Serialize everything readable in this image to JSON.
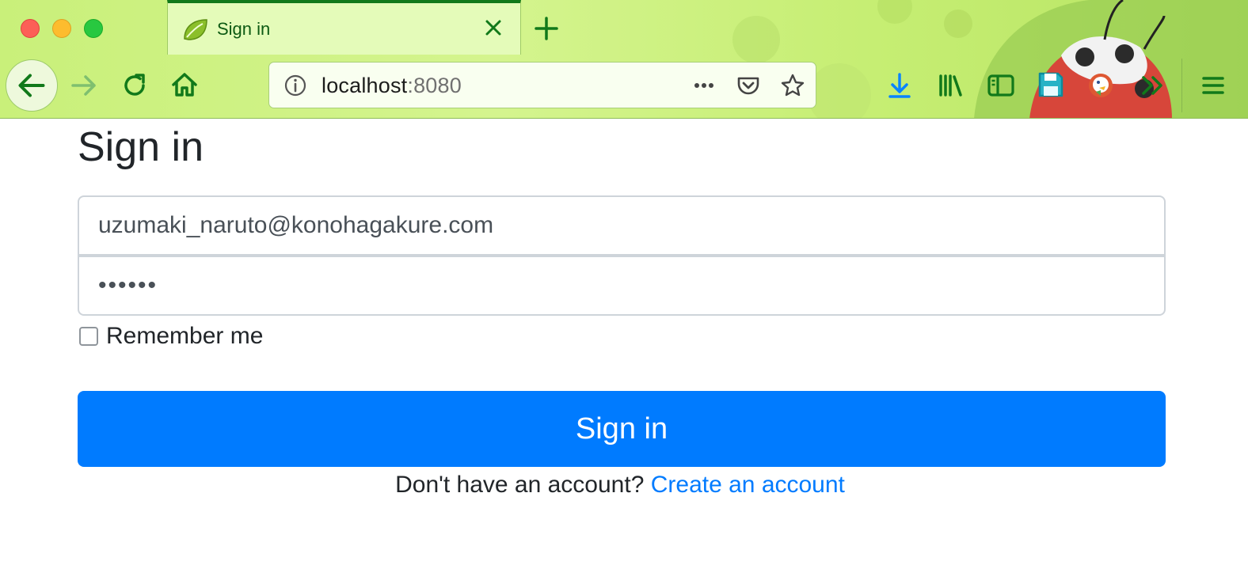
{
  "browser": {
    "tab": {
      "title": "Sign in",
      "favicon": "spring-leaf-icon"
    },
    "url": {
      "host": "localhost",
      "port": ":8080"
    },
    "toolbar_icons": [
      "back-arrow-icon",
      "forward-arrow-icon",
      "reload-icon",
      "home-icon",
      "info-icon",
      "more-icon",
      "pocket-icon",
      "star-icon",
      "download-icon",
      "library-icon",
      "sidebar-icon",
      "save-icon",
      "duckduckgo-icon",
      "overflow-chevron-icon",
      "menu-icon"
    ],
    "colors": {
      "accent": "#11791a",
      "theme_background": "#c9f07a",
      "download_blue": "#0a84ff"
    }
  },
  "page": {
    "title": "Sign in",
    "email": {
      "value": "uzumaki_naruto@konohagakure.com"
    },
    "password": {
      "value": "••••••"
    },
    "remember_me": {
      "label": "Remember me",
      "checked": false
    },
    "submit_label": "Sign in",
    "footer": {
      "text": "Don't have an account?",
      "link_text": "Create an account"
    },
    "colors": {
      "primary": "#007bff",
      "text": "#212529",
      "input_border": "#ced4da"
    }
  }
}
